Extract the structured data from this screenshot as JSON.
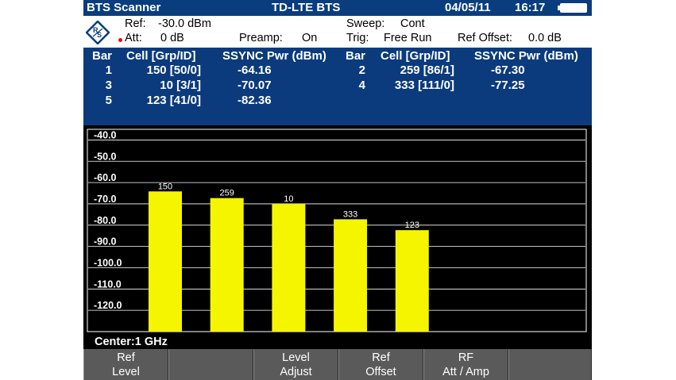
{
  "titlebar": {
    "app": "BTS Scanner",
    "mode": "TD-LTE BTS",
    "date": "04/05/11",
    "time": "16:17"
  },
  "settings": {
    "ref_label": "Ref:",
    "ref_value": "-30.0 dBm",
    "att_label": "Att:",
    "att_value": "0 dB",
    "preamp_label": "Preamp:",
    "preamp_value": "On",
    "sweep_label": "Sweep:",
    "sweep_value": "Cont",
    "trig_label": "Trig:",
    "trig_value": "Free Run",
    "ref_offset_label": "Ref Offset:",
    "ref_offset_value": "0.0 dB"
  },
  "table": {
    "headers": {
      "bar": "Bar",
      "cell": "Cell [Grp/ID]",
      "pwr": "SSYNC Pwr (dBm)"
    },
    "left_rows": [
      {
        "bar": "1",
        "cell": "150 [50/0]",
        "pwr": "-64.16"
      },
      {
        "bar": "3",
        "cell": "10 [3/1]",
        "pwr": "-70.07"
      },
      {
        "bar": "5",
        "cell": "123 [41/0]",
        "pwr": "-82.36"
      }
    ],
    "right_rows": [
      {
        "bar": "2",
        "cell": "259 [86/1]",
        "pwr": "-67.30"
      },
      {
        "bar": "4",
        "cell": "333 [111/0]",
        "pwr": "-77.25"
      }
    ]
  },
  "chart_data": {
    "type": "bar",
    "categories": [
      "150",
      "259",
      "10",
      "333",
      "123"
    ],
    "values": [
      -64.16,
      -67.3,
      -70.07,
      -77.25,
      -82.36
    ],
    "ylim": [
      -130,
      -35
    ],
    "yticks": [
      "-40.0",
      "-50.0",
      "-60.0",
      "-70.0",
      "-80.0",
      "-90.0",
      "-100.0",
      "-110.0",
      "-120.0"
    ],
    "ytick_values": [
      -40,
      -50,
      -60,
      -70,
      -80,
      -90,
      -100,
      -110,
      -120
    ],
    "bar_color": "#f5f500",
    "grid": true
  },
  "center": "Center:1 GHz",
  "softkeys": [
    {
      "line1": "Ref",
      "line2": "Level"
    },
    {
      "line1": "",
      "line2": ""
    },
    {
      "line1": "Level",
      "line2": "Adjust"
    },
    {
      "line1": "Ref",
      "line2": "Offset"
    },
    {
      "line1": "RF",
      "line2": "Att / Amp"
    },
    {
      "line1": "",
      "line2": ""
    }
  ],
  "colors": {
    "title_bg": "#0a3d7d",
    "table_bg": "#0b3b7d",
    "softkey_bg": "#5a5a5a",
    "bar": "#f5f500"
  }
}
